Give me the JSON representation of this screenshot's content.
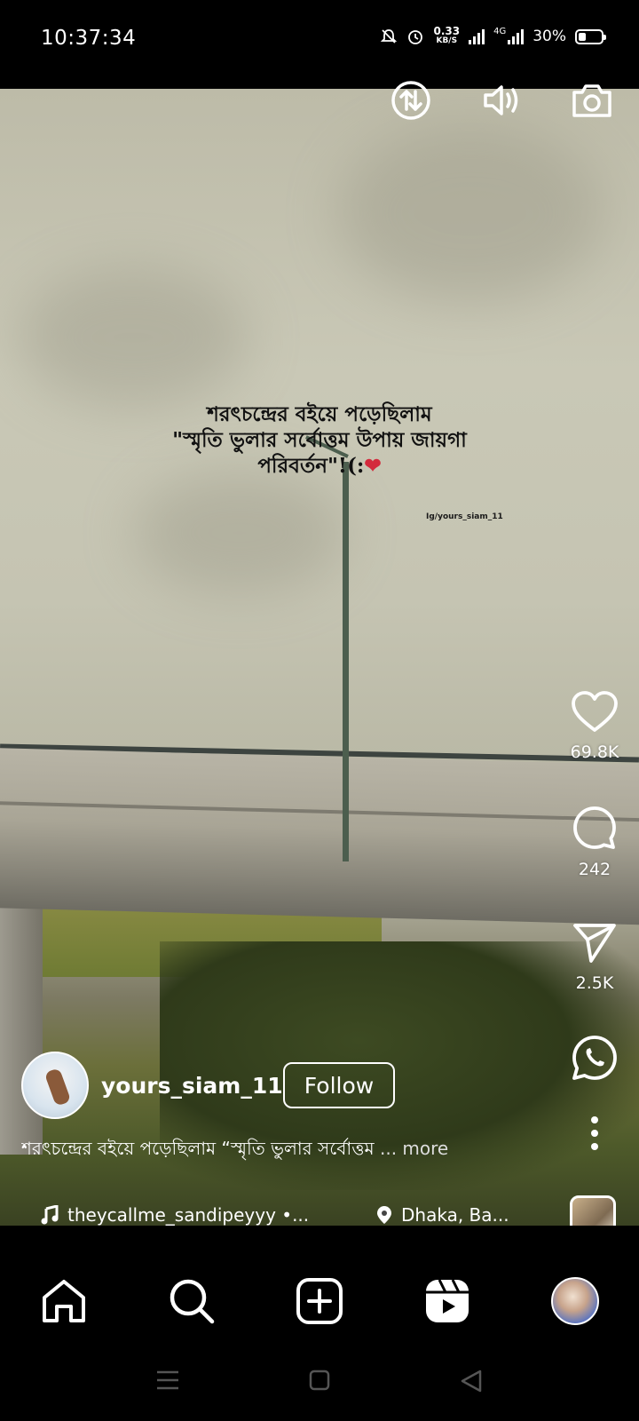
{
  "status_bar": {
    "time": "10:37:34",
    "net_speed_value": "0.33",
    "net_speed_unit": "KB/S",
    "network_type": "4G",
    "battery": "30%"
  },
  "reel": {
    "overlay_text_line1": "শরৎচন্দ্রের বইয়ে পড়েছিলাম",
    "overlay_text_line2": "\"স্মৃতি ভুলার সর্বোত্তম উপায় জায়গা",
    "overlay_text_line3": "পরিবর্তন\"!(:",
    "overlay_emoji": "❤",
    "watermark": "Ig/yours_siam_11"
  },
  "actions": {
    "likes": "69.8K",
    "comments": "242",
    "shares": "2.5K"
  },
  "author": {
    "username": "yours_siam_11",
    "follow_label": "Follow"
  },
  "caption": {
    "text": "শরৎচন্দ্রের বইয়ে পড়েছিলাম “স্মৃতি ভুলার সর্বোত্তম",
    "more": " ... more"
  },
  "audio": {
    "track": "theycallme_sandipeyyy  •..."
  },
  "location": {
    "text": "Dhaka, Ba..."
  },
  "icons": {
    "top": [
      "data-saver-icon",
      "volume-icon",
      "camera-icon"
    ],
    "rail": [
      "heart-icon",
      "comment-icon",
      "share-icon",
      "whatsapp-icon",
      "more-icon"
    ],
    "nav": [
      "home-icon",
      "search-icon",
      "create-icon",
      "reels-icon",
      "profile-icon"
    ]
  }
}
